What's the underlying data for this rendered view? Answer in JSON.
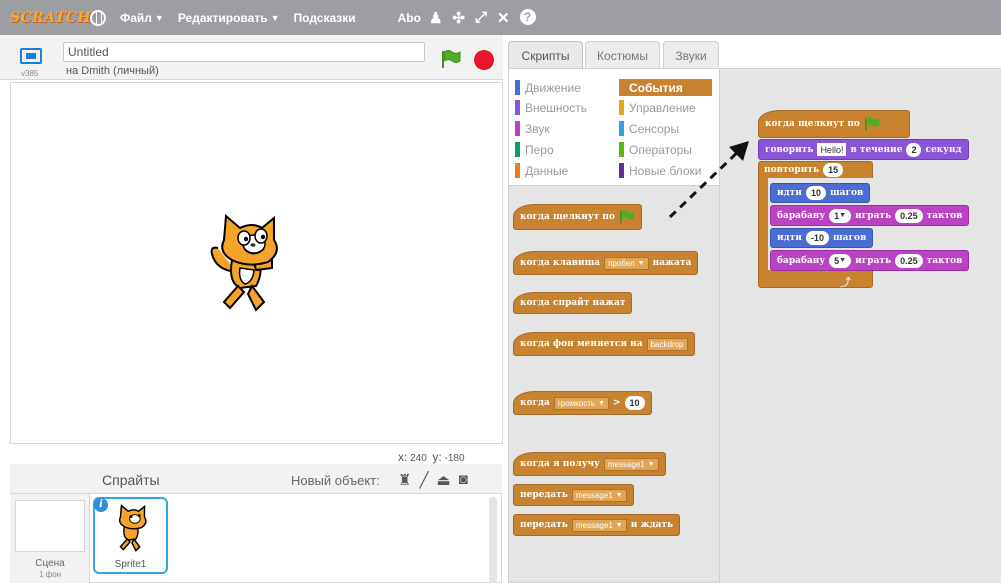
{
  "menubar": {
    "logo": "SCRATCH",
    "file": "Файл",
    "edit": "Редактировать",
    "tips": "Подсказки",
    "about": "Abo",
    "caret": "▼"
  },
  "stage": {
    "project_title": "Untitled",
    "owner": "на Dmith (личный)",
    "version": "v385",
    "x_label": "x:",
    "x_value": "240",
    "y_label": "y:",
    "y_value": "-180"
  },
  "sprites": {
    "title": "Спрайты",
    "new_object": "Новый объект:",
    "scene_label": "Сцена",
    "scene_sub": "1 фон",
    "sprite_name": "Sprite1",
    "info": "i"
  },
  "tabs": {
    "scripts": "Скрипты",
    "costumes": "Костюмы",
    "sounds": "Звуки"
  },
  "categories": {
    "motion": "Движение",
    "looks": "Внешность",
    "sound": "Звук",
    "pen": "Перо",
    "data": "Данные",
    "events": "События",
    "control": "Управление",
    "sensing": "Сенсоры",
    "operators": "Операторы",
    "more": "Новые блоки"
  },
  "palette": {
    "when_flag": "когда щелкнут по",
    "when_key": "когда клавиша",
    "key_value": "пробел",
    "key_pressed": "нажата",
    "when_sprite_clicked": "когда спрайт нажат",
    "when_backdrop": "когда фон меняется на",
    "backdrop_value": "backdrop",
    "when_label": "когда",
    "loudness": "громкость",
    "gt": ">",
    "loudness_value": "10",
    "when_receive": "когда я получу",
    "message": "message1",
    "broadcast": "передать",
    "broadcast_wait_suffix": "и ждать"
  },
  "script": {
    "hat": "когда щелкнут по",
    "say": "говорить",
    "say_text": "Hello!",
    "say_for": "в течение",
    "say_secs": "2",
    "say_unit": "секунд",
    "repeat": "повторить",
    "repeat_count": "15",
    "move1": "идти",
    "move1_steps": "10",
    "steps": "шагов",
    "drum1": "барабану",
    "drum1_num": "1",
    "play": "играть",
    "beats": "0.25",
    "beats_unit": "тактов",
    "move2": "идти",
    "move2_steps": "-10",
    "drum2": "барабану",
    "drum2_num": "5"
  },
  "colors": {
    "events": "#c88330",
    "motion": "#4a6cd4",
    "looks": "#8a55d7",
    "sound": "#bb42c3",
    "pen": "#0e9a6c",
    "data": "#ee7d16",
    "control": "#e1a91a",
    "sensing": "#2ca5e2",
    "operators": "#5cb712",
    "more": "#632d99"
  }
}
